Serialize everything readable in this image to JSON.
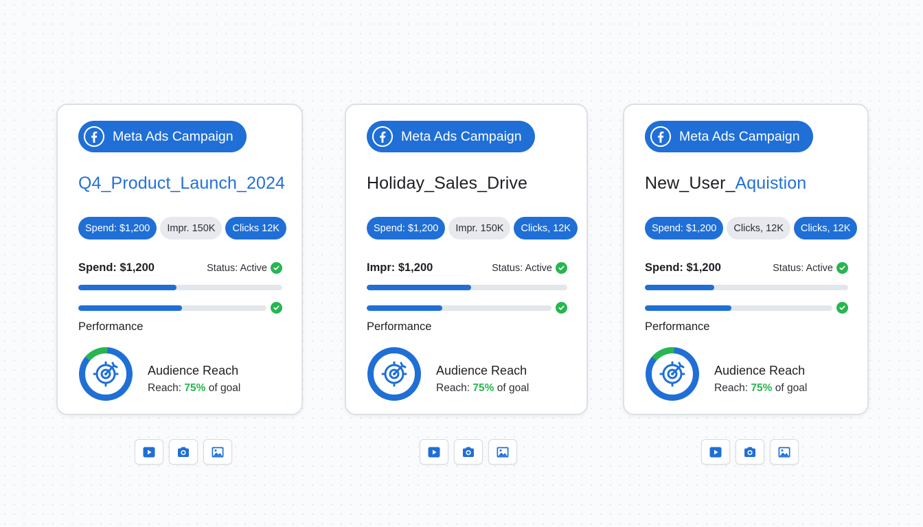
{
  "colors": {
    "accent": "#1f6fd6",
    "success": "#27b650",
    "track": "#e3e6ea"
  },
  "cards": [
    {
      "badge": "Meta Ads Campaign",
      "title_main": "Q4_Product_Launch_2024",
      "title_highlight": "",
      "chips": [
        {
          "label": "Spend: $1,200",
          "style": "blue"
        },
        {
          "label": "Impr. 150K",
          "style": "gray"
        },
        {
          "label": "Clicks 12K",
          "style": "blue"
        }
      ],
      "metric_label": "Spend: $1,200",
      "status": "Status: Active",
      "bar1_progress": 0.48,
      "bar2_progress": 0.55,
      "performance_label": "Performance",
      "ring_progress": 0.15,
      "reach_title": "Audience Reach",
      "reach_prefix": "Reach: ",
      "reach_pct": "75%",
      "reach_suffix": " of goal"
    },
    {
      "badge": "Meta Ads Campaign",
      "title_main": "Holiday_Sales_Drive",
      "title_highlight": "",
      "chips": [
        {
          "label": "Spend: $1,200",
          "style": "blue"
        },
        {
          "label": "Impr. 150K",
          "style": "gray"
        },
        {
          "label": "Clicks, 12K",
          "style": "blue"
        }
      ],
      "metric_label": "Impr: $1,200",
      "status": "Status: Active",
      "bar1_progress": 0.52,
      "bar2_progress": 0.41,
      "performance_label": "Performance",
      "ring_progress": 0,
      "reach_title": "Audience Reach",
      "reach_prefix": "Reach: ",
      "reach_pct": "75%",
      "reach_suffix": " of goal"
    },
    {
      "badge": "Meta Ads Campaign",
      "title_main": "New_User_",
      "title_highlight": "Aquistion",
      "chips": [
        {
          "label": "Spend: $1,200",
          "style": "blue"
        },
        {
          "label": "Clicks, 12K",
          "style": "gray"
        },
        {
          "label": "Clicks, 12K",
          "style": "blue"
        }
      ],
      "metric_label": "Spend: $1,200",
      "status": "Status: Active",
      "bar1_progress": 0.34,
      "bar2_progress": 0.46,
      "performance_label": "Performance",
      "ring_progress": 0.15,
      "reach_title": "Audience Reach",
      "reach_prefix": "Reach: ",
      "reach_pct": "75%",
      "reach_suffix": " of goal"
    }
  ]
}
